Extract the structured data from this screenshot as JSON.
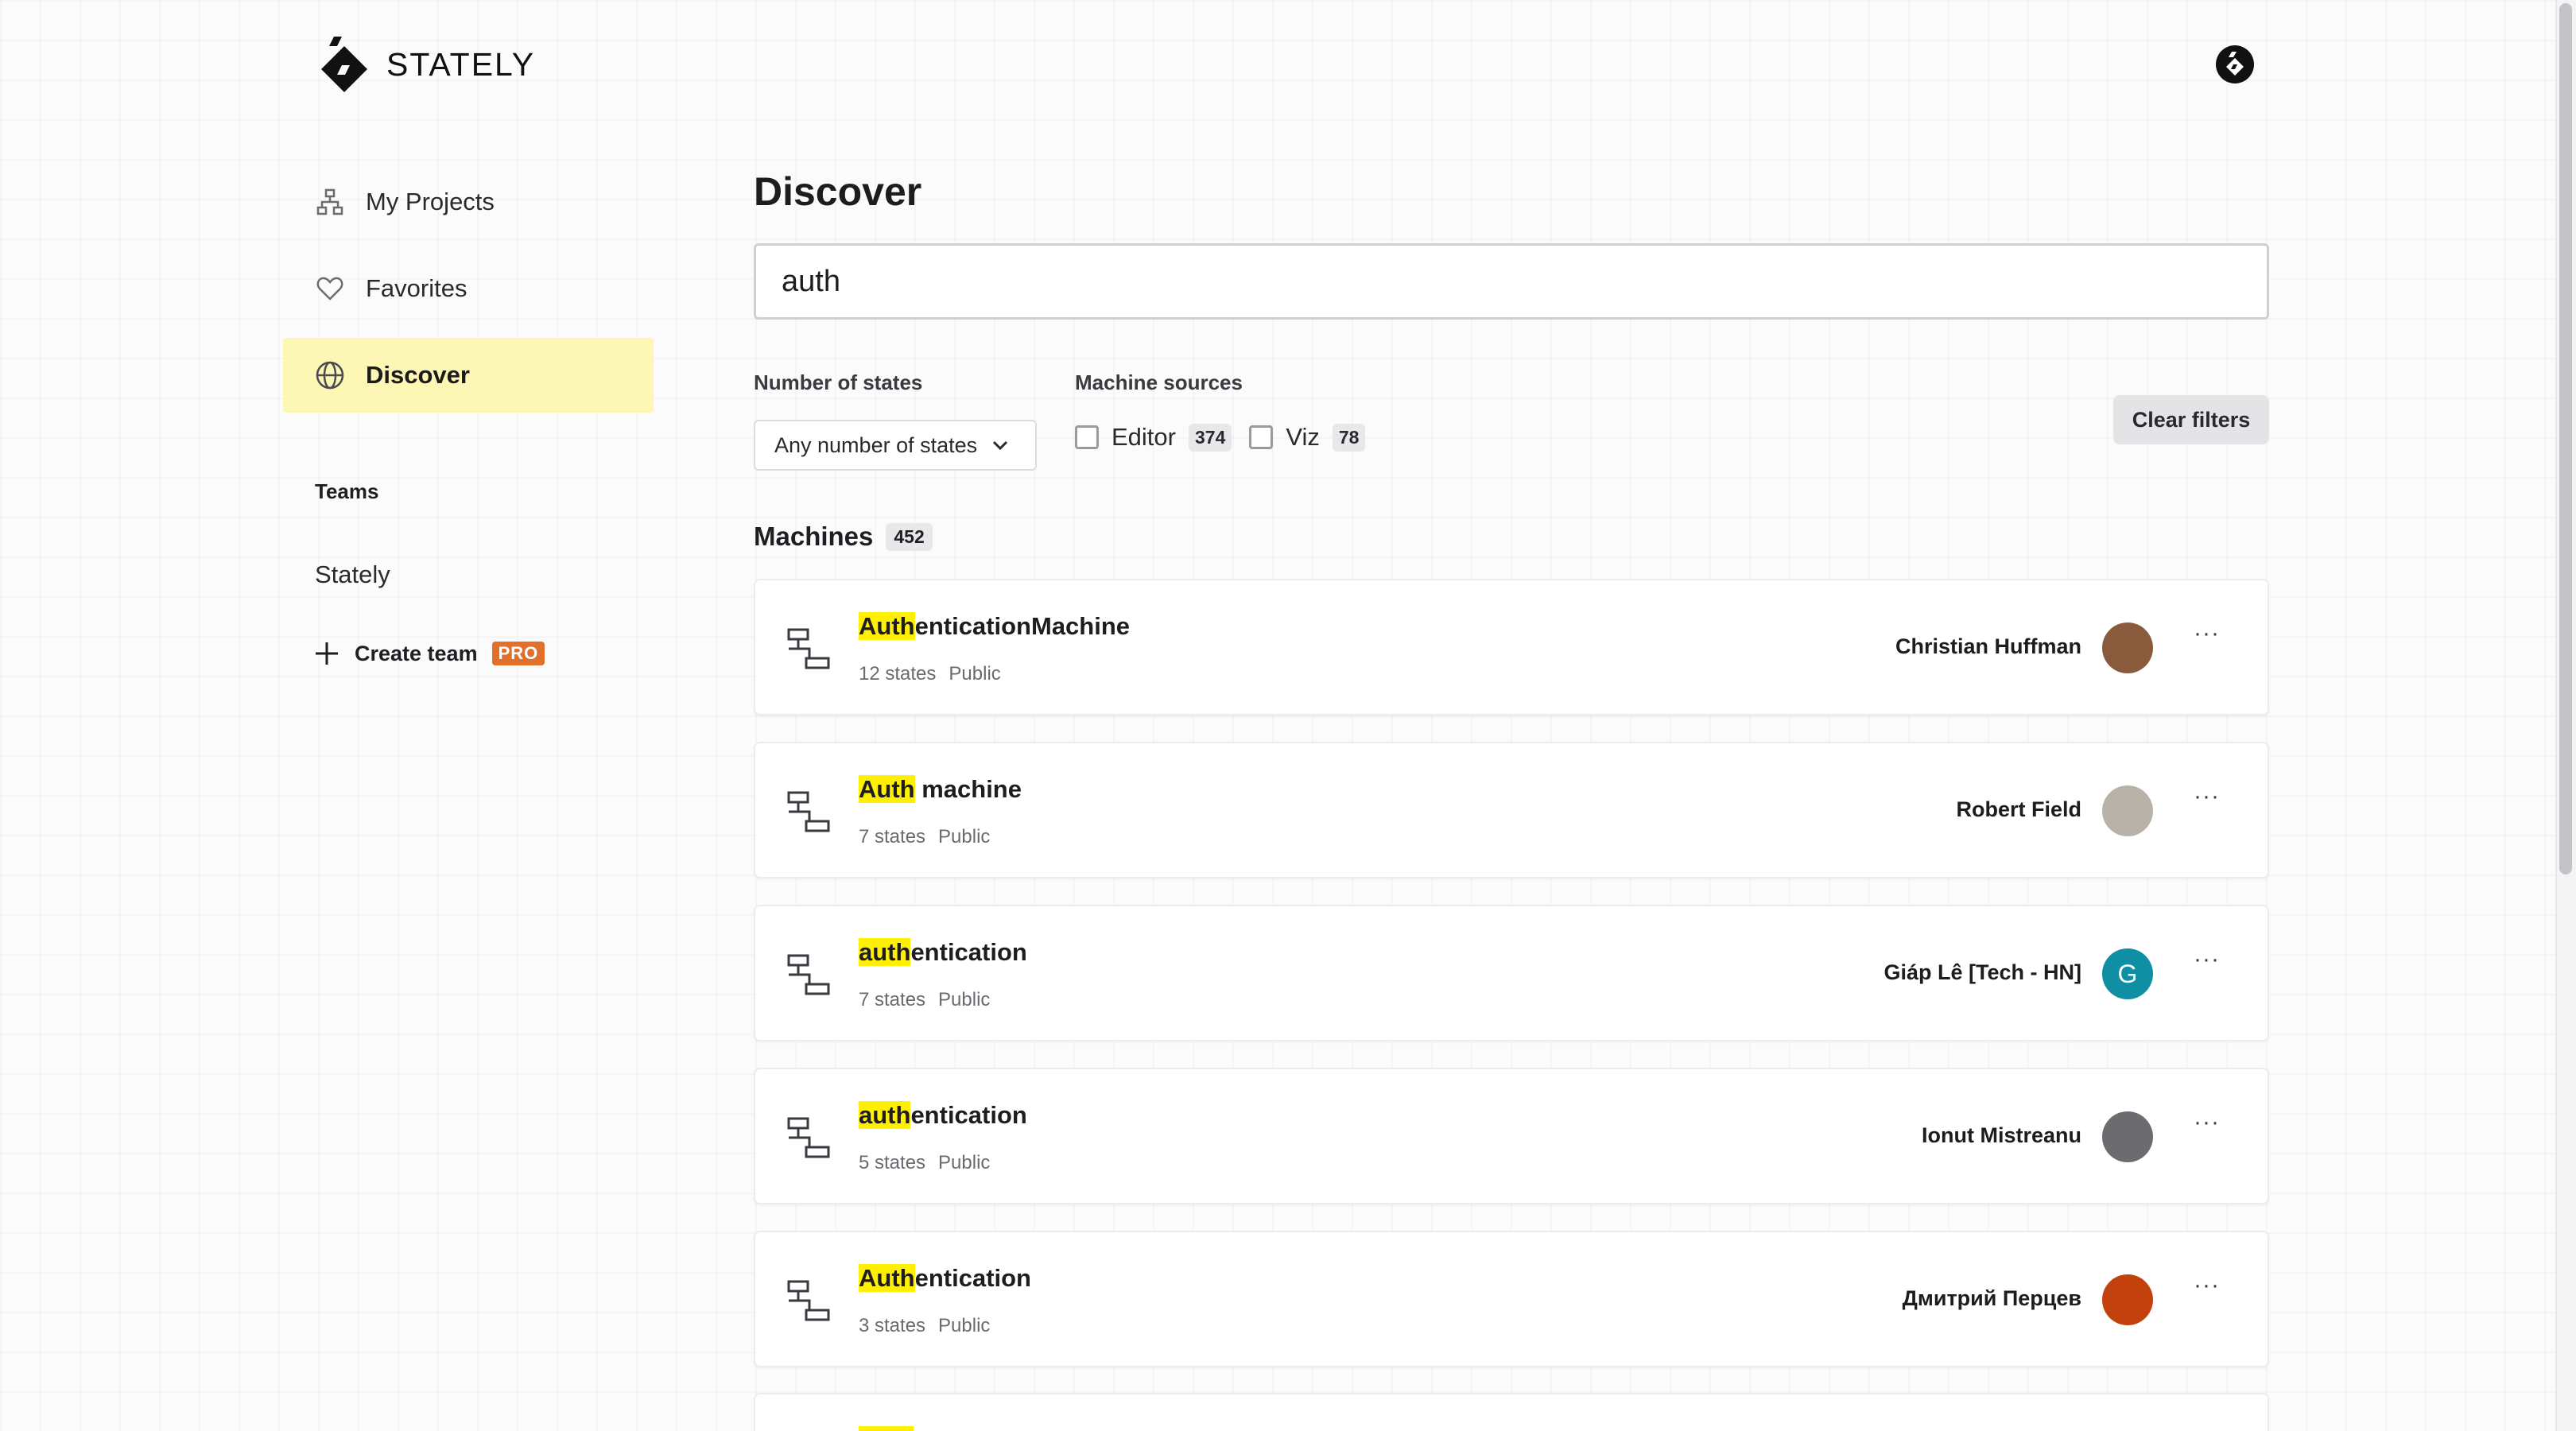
{
  "app": {
    "name": "STATELY"
  },
  "sidebar": {
    "items": [
      {
        "label": "My Projects",
        "icon": "sitemap-icon"
      },
      {
        "label": "Favorites",
        "icon": "heart-icon"
      },
      {
        "label": "Discover",
        "icon": "globe-icon",
        "active": true
      }
    ],
    "teams_label": "Teams",
    "teams": [
      {
        "label": "Stately"
      }
    ],
    "create_team_label": "Create team",
    "pro_badge": "PRO"
  },
  "main": {
    "title": "Discover",
    "search": {
      "value": "auth"
    },
    "filters": {
      "states_label": "Number of states",
      "states_selected": "Any number of states",
      "sources_label": "Machine sources",
      "sources": [
        {
          "label": "Editor",
          "count": "374",
          "checked": false
        },
        {
          "label": "Viz",
          "count": "78",
          "checked": false
        }
      ],
      "clear_label": "Clear filters"
    },
    "machines_label": "Machines",
    "machines_count": "452",
    "machines": [
      {
        "hl": "Auth",
        "rest": "enticationMachine",
        "states": "12 states",
        "visibility": "Public",
        "owner": "Christian Huffman",
        "avatar_color": "#8a5a3c",
        "avatar_letter": ""
      },
      {
        "hl": "Auth",
        "rest": " machine",
        "states": "7 states",
        "visibility": "Public",
        "owner": "Robert Field",
        "avatar_color": "#b9b2a8",
        "avatar_letter": ""
      },
      {
        "hl": "auth",
        "rest": "entication",
        "states": "7 states",
        "visibility": "Public",
        "owner": "Giáp Lê [Tech - HN]",
        "avatar_color": "#0f8fa3",
        "avatar_letter": "G"
      },
      {
        "hl": "auth",
        "rest": "entication",
        "states": "5 states",
        "visibility": "Public",
        "owner": "Ionut Mistreanu",
        "avatar_color": "#6b6b70",
        "avatar_letter": ""
      },
      {
        "hl": "Auth",
        "rest": "entication",
        "states": "3 states",
        "visibility": "Public",
        "owner": "Дмитрий Перцев",
        "avatar_color": "#c2410c",
        "avatar_letter": ""
      }
    ],
    "more_label": "···"
  }
}
